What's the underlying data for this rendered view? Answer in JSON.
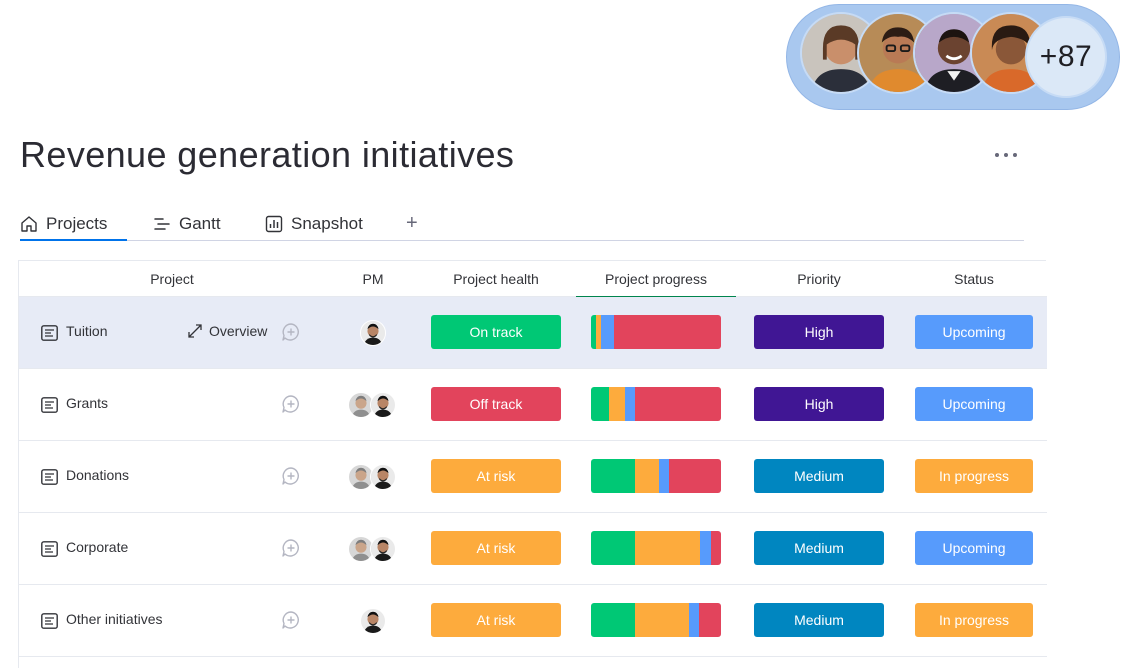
{
  "collaborators": {
    "more_count": "+87",
    "faces": [
      "avatar-woman-1",
      "avatar-man-glasses",
      "avatar-man-smiling",
      "avatar-woman-2"
    ]
  },
  "board": {
    "title": "Revenue generation initiatives",
    "more_menu_icon": "more-horizontal-icon"
  },
  "tabs": [
    {
      "label": "Projects",
      "icon": "home-icon",
      "active": true
    },
    {
      "label": "Gantt",
      "icon": "gantt-icon",
      "active": false
    },
    {
      "label": "Snapshot",
      "icon": "chart-icon",
      "active": false
    }
  ],
  "add_view_label": "+",
  "columns": {
    "project": "Project",
    "pm": "PM",
    "health": "Project health",
    "progress": "Project progress",
    "priority": "Priority",
    "status": "Status"
  },
  "overview_label": "Overview",
  "colors": {
    "green": "#00c875",
    "red": "#e2445c",
    "orange": "#fdab3d",
    "blue": "#579bfc",
    "dark_purple": "#401694",
    "teal_blue": "#0086c0",
    "accent": "#0073ea"
  },
  "rows": [
    {
      "name": "Tuition",
      "pm_count": 1,
      "health": "On track",
      "health_color": "#00c875",
      "progress": [
        {
          "color": "#00c875",
          "fraction": 0.04
        },
        {
          "color": "#fdab3d",
          "fraction": 0.04
        },
        {
          "color": "#579bfc",
          "fraction": 0.1
        },
        {
          "color": "#e2445c",
          "fraction": 0.82
        }
      ],
      "priority": "High",
      "priority_color": "#401694",
      "status": "Upcoming",
      "status_color": "#579bfc"
    },
    {
      "name": "Grants",
      "pm_count": 2,
      "health": "Off track",
      "health_color": "#e2445c",
      "progress": [
        {
          "color": "#00c875",
          "fraction": 0.14
        },
        {
          "color": "#fdab3d",
          "fraction": 0.12
        },
        {
          "color": "#579bfc",
          "fraction": 0.08
        },
        {
          "color": "#e2445c",
          "fraction": 0.66
        }
      ],
      "priority": "High",
      "priority_color": "#401694",
      "status": "Upcoming",
      "status_color": "#579bfc"
    },
    {
      "name": "Donations",
      "pm_count": 2,
      "health": "At risk",
      "health_color": "#fdab3d",
      "progress": [
        {
          "color": "#00c875",
          "fraction": 0.34
        },
        {
          "color": "#fdab3d",
          "fraction": 0.18
        },
        {
          "color": "#579bfc",
          "fraction": 0.08
        },
        {
          "color": "#e2445c",
          "fraction": 0.4
        }
      ],
      "priority": "Medium",
      "priority_color": "#0086c0",
      "status": "In progress",
      "status_color": "#fdab3d"
    },
    {
      "name": "Corporate",
      "pm_count": 2,
      "health": "At risk",
      "health_color": "#fdab3d",
      "progress": [
        {
          "color": "#00c875",
          "fraction": 0.34
        },
        {
          "color": "#fdab3d",
          "fraction": 0.5
        },
        {
          "color": "#579bfc",
          "fraction": 0.08
        },
        {
          "color": "#e2445c",
          "fraction": 0.08
        }
      ],
      "priority": "Medium",
      "priority_color": "#0086c0",
      "status": "Upcoming",
      "status_color": "#579bfc"
    },
    {
      "name": "Other initiatives",
      "pm_count": 1,
      "health": "At risk",
      "health_color": "#fdab3d",
      "progress": [
        {
          "color": "#00c875",
          "fraction": 0.34
        },
        {
          "color": "#fdab3d",
          "fraction": 0.41
        },
        {
          "color": "#579bfc",
          "fraction": 0.08
        },
        {
          "color": "#e2445c",
          "fraction": 0.17
        }
      ],
      "priority": "Medium",
      "priority_color": "#0086c0",
      "status": "In progress",
      "status_color": "#fdab3d"
    }
  ]
}
